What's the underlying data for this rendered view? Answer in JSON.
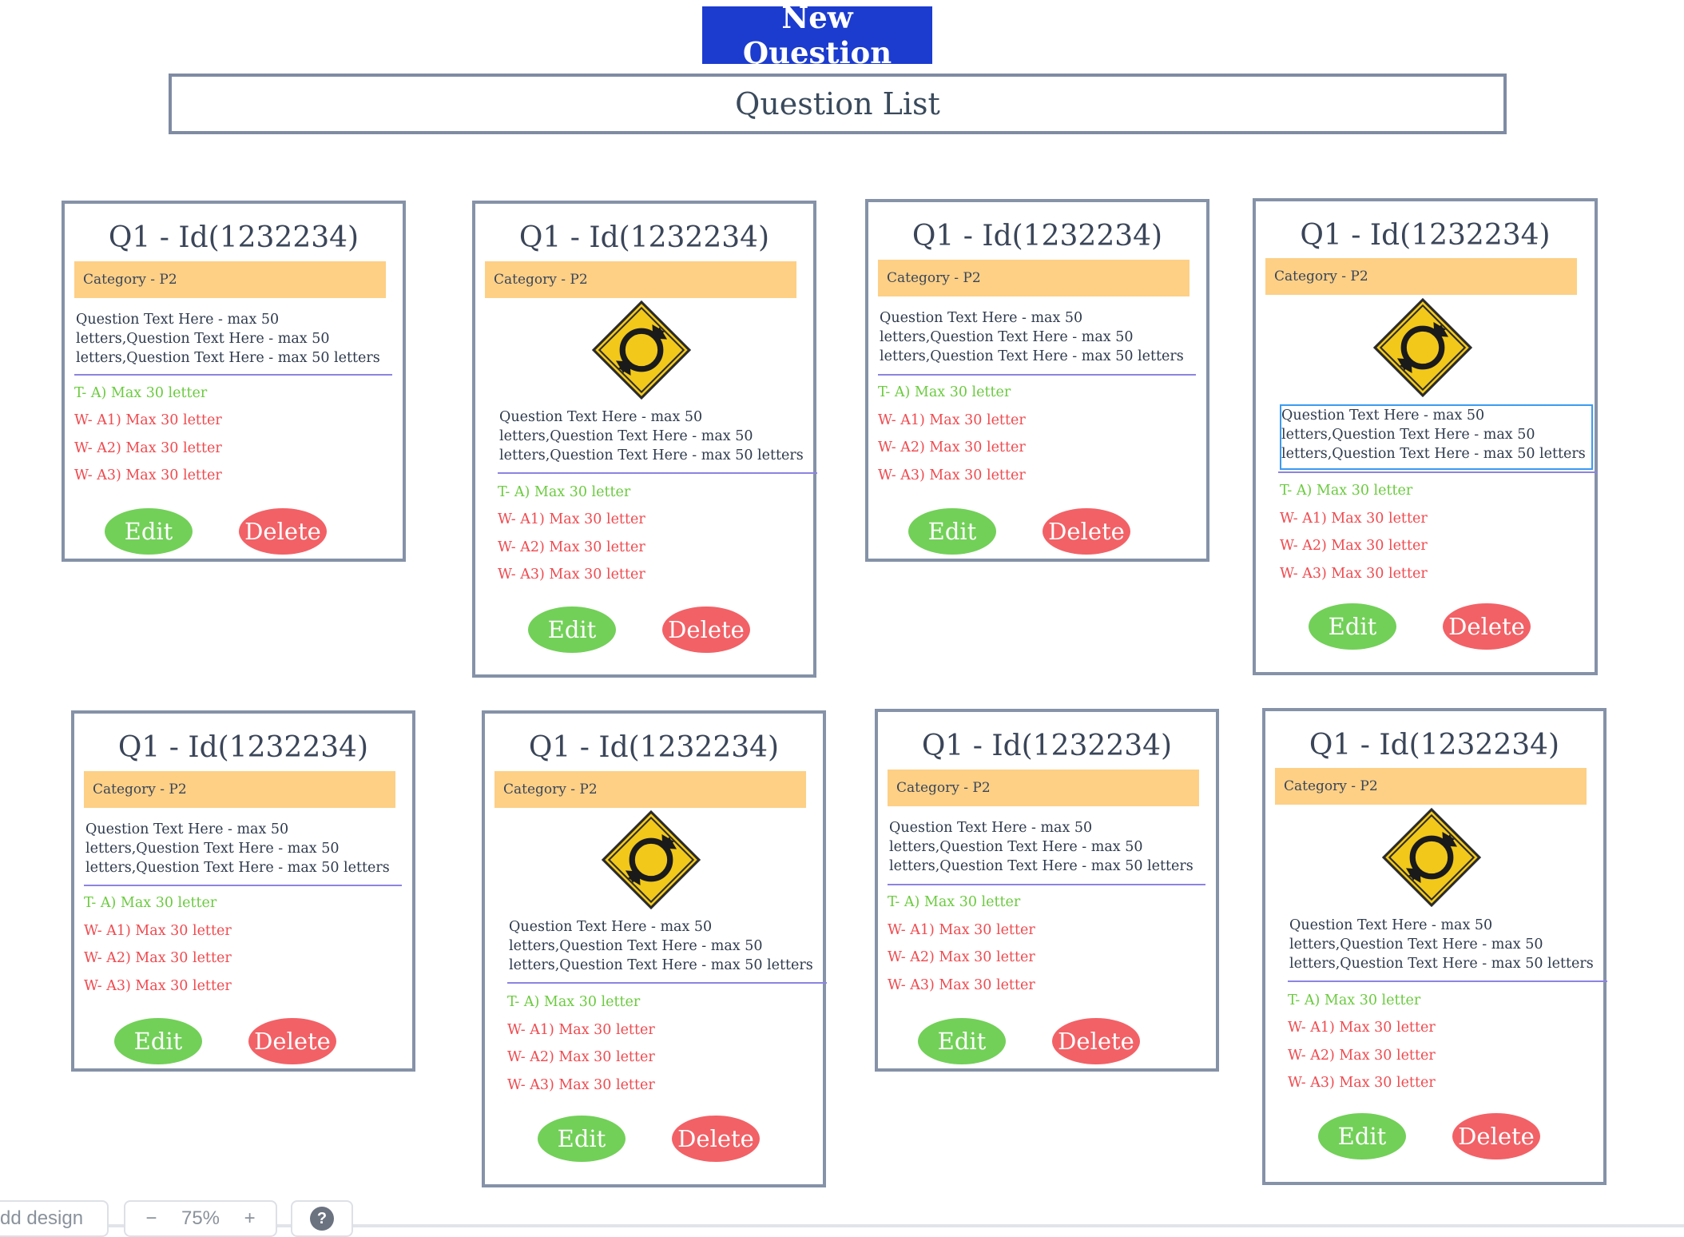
{
  "header": {
    "new_question_label": "New Question"
  },
  "list": {
    "title": "Question List"
  },
  "cards": [
    {
      "title": "Q1 - Id(1232234)",
      "category": "Category - P2",
      "question": "Question Text Here - max 50 letters,Question Text Here - max 50 letters,Question Text Here - max 50 letters",
      "answers": [
        "T- A) Max 30 letter",
        "W- A1) Max 30 letter",
        "W- A2) Max 30 letter",
        "W- A3) Max 30 letter"
      ],
      "edit_label": "Edit",
      "delete_label": "Delete"
    },
    {
      "title": "Q1 - Id(1232234)",
      "category": "Category - P2",
      "question": "Question Text Here - max 50 letters,Question Text Here - max 50 letters,Question Text Here - max 50 letters",
      "answers": [
        "T- A) Max 30 letter",
        "W- A1) Max 30 letter",
        "W- A2) Max 30 letter",
        "W- A3) Max 30 letter"
      ],
      "edit_label": "Edit",
      "delete_label": "Delete",
      "image": "roundabout-sign-icon"
    },
    {
      "title": "Q1 - Id(1232234)",
      "category": "Category - P2",
      "question": "Question Text Here - max 50 letters,Question Text Here - max 50 letters,Question Text Here - max 50 letters",
      "answers": [
        "T- A) Max 30 letter",
        "W- A1) Max 30 letter",
        "W- A2) Max 30 letter",
        "W- A3) Max 30 letter"
      ],
      "edit_label": "Edit",
      "delete_label": "Delete"
    },
    {
      "title": "Q1 - Id(1232234)",
      "category": "Category - P2",
      "question": "Question Text Here - max 50 letters,Question Text Here - max 50 letters,Question Text Here - max 50 letters",
      "answers": [
        "T- A) Max 30 letter",
        "W- A1) Max 30 letter",
        "W- A2) Max 30 letter",
        "W- A3) Max 30 letter"
      ],
      "edit_label": "Edit",
      "delete_label": "Delete",
      "image": "roundabout-sign-icon"
    },
    {
      "title": "Q1 - Id(1232234)",
      "category": "Category - P2",
      "question": "Question Text Here - max 50 letters,Question Text Here - max 50 letters,Question Text Here - max 50 letters",
      "answers": [
        "T- A) Max 30 letter",
        "W- A1) Max 30 letter",
        "W- A2) Max 30 letter",
        "W- A3) Max 30 letter"
      ],
      "edit_label": "Edit",
      "delete_label": "Delete"
    },
    {
      "title": "Q1 - Id(1232234)",
      "category": "Category - P2",
      "question": "Question Text Here - max 50 letters,Question Text Here - max 50 letters,Question Text Here - max 50 letters",
      "answers": [
        "T- A) Max 30 letter",
        "W- A1) Max 30 letter",
        "W- A2) Max 30 letter",
        "W- A3) Max 30 letter"
      ],
      "edit_label": "Edit",
      "delete_label": "Delete",
      "image": "roundabout-sign-icon"
    },
    {
      "title": "Q1 - Id(1232234)",
      "category": "Category - P2",
      "question": "Question Text Here - max 50 letters,Question Text Here - max 50 letters,Question Text Here - max 50 letters",
      "answers": [
        "T- A) Max 30 letter",
        "W- A1) Max 30 letter",
        "W- A2) Max 30 letter",
        "W- A3) Max 30 letter"
      ],
      "edit_label": "Edit",
      "delete_label": "Delete"
    },
    {
      "title": "Q1 - Id(1232234)",
      "category": "Category - P2",
      "question": "Question Text Here - max 50 letters,Question Text Here - max 50 letters,Question Text Here - max 50 letters",
      "answers": [
        "T- A) Max 30 letter",
        "W- A1) Max 30 letter",
        "W- A2) Max 30 letter",
        "W- A3) Max 30 letter"
      ],
      "edit_label": "Edit",
      "delete_label": "Delete",
      "image": "roundabout-sign-icon"
    }
  ],
  "footer": {
    "add_design_label": "dd design",
    "zoom_value": "75%",
    "zoom_out": "−",
    "zoom_in": "+",
    "help": "?"
  }
}
